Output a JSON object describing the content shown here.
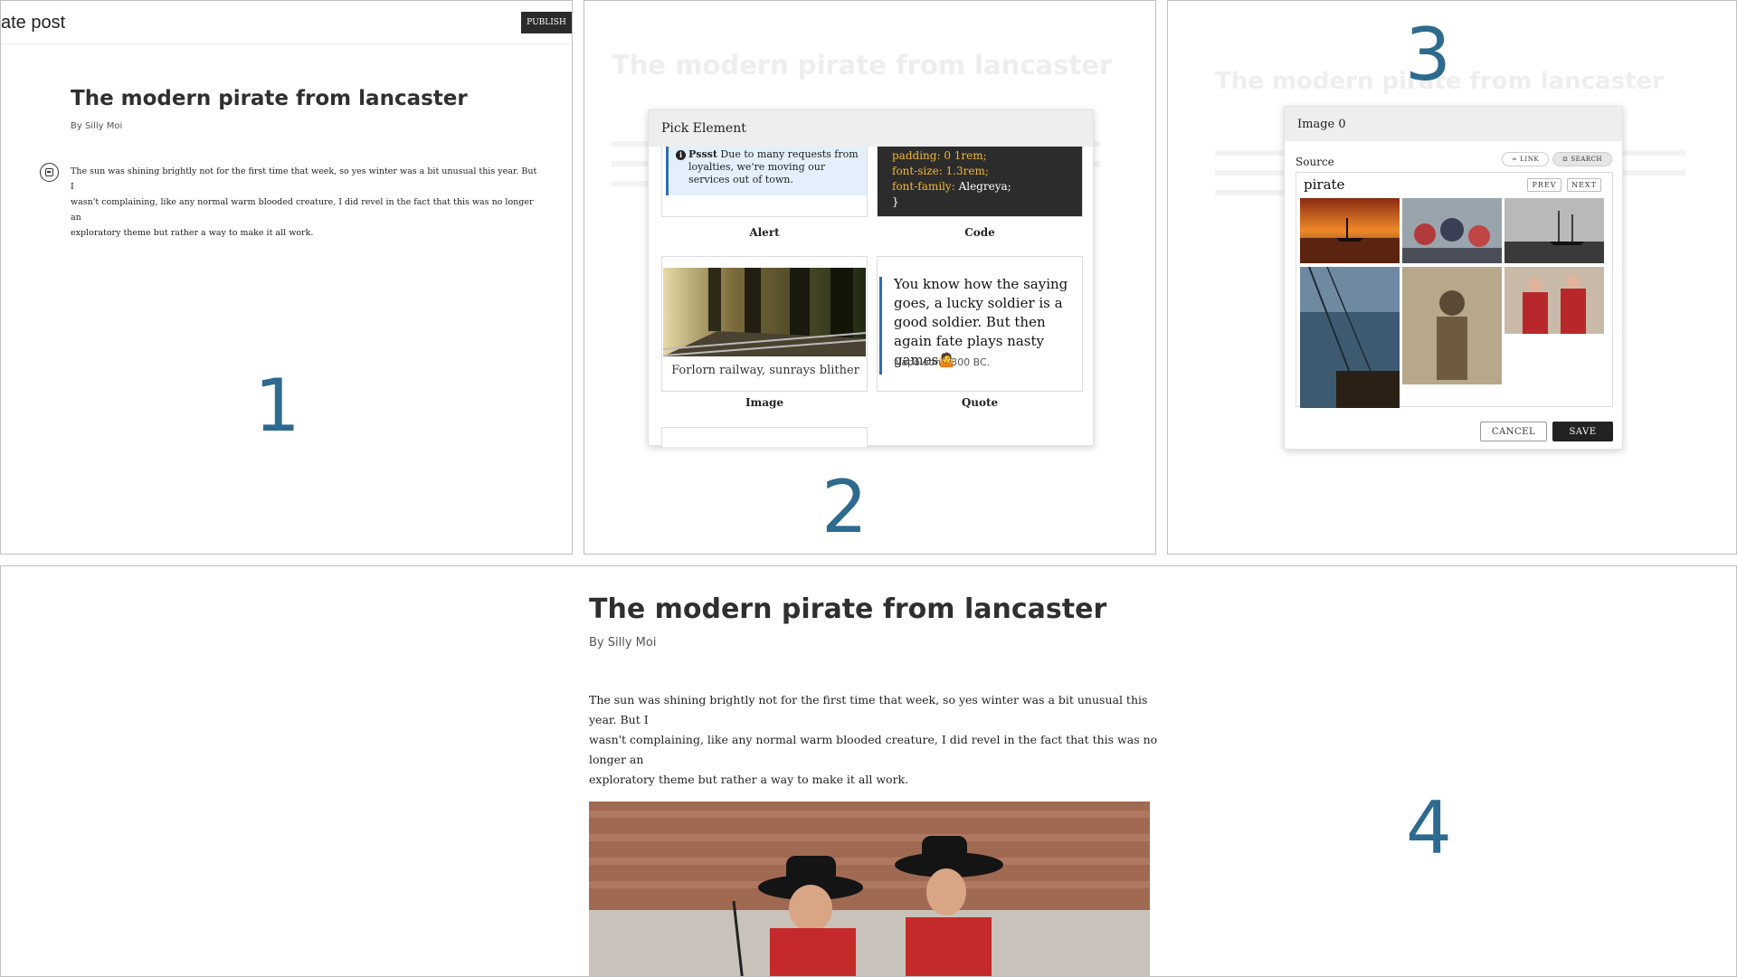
{
  "panel1": {
    "page_title": "ate post",
    "publish_label": "PUBLISH",
    "post_title": "The modern pirate from lancaster",
    "byline": "By Silly Moi",
    "body_lines": [
      "The sun was shining brightly not for the first time that week, so yes winter was a bit unusual this year. But I",
      "wasn't complaining, like any normal warm blooded creature, I did revel in the fact that this was no longer an",
      "exploratory theme but rather a way to make it all work."
    ],
    "step": "1"
  },
  "panel2": {
    "ghost_title": "The modern pirate from lancaster",
    "modal_title": "Pick Element",
    "alert": {
      "bold": "Pssst",
      "text": " Due to many requests from loyalties, we're moving our services out of town."
    },
    "code": {
      "lines": [
        {
          "key": "padding:",
          "val": " 0 1rem;"
        },
        {
          "key": "font-size:",
          "val": " 1.3rem;"
        },
        {
          "key": "font-family:",
          "val": " Alegreya;"
        }
      ],
      "close": "}"
    },
    "image_caption": "Forlorn railway, sunrays blither",
    "quote": {
      "text": "You know how the saying goes, a lucky soldier is a good soldier. But then again fate plays nasty games🤷",
      "attr": "Napoleon - 300 BC."
    },
    "labels": {
      "alert": "Alert",
      "code": "Code",
      "image": "Image",
      "quote": "Quote"
    },
    "step": "2"
  },
  "panel3": {
    "ghost_title": "The modern pirate from lancaster",
    "modal_title": "Image 0",
    "source_label": "Source",
    "link_label": "LINK",
    "search_label": "SEARCH",
    "query": "pirate",
    "prev_label": "PREV",
    "next_label": "NEXT",
    "cancel_label": "CANCEL",
    "save_label": "SAVE",
    "step": "3"
  },
  "panel4": {
    "post_title": "The modern pirate from lancaster",
    "byline": "By Silly Moi",
    "body_lines": [
      "The sun was shining brightly not for the first time that week, so yes winter was a bit unusual this year. But I",
      "wasn't complaining, like any normal warm blooded creature, I did revel in the fact that this was no longer an",
      "exploratory theme but rather a way to make it all work."
    ],
    "step": "4"
  },
  "colors": {
    "accent": "#2d6a8f",
    "quote_bar": "#2d6db5",
    "alert_bg": "#e3f0fb",
    "code_key": "#f2b833",
    "button_dark": "#222222"
  }
}
